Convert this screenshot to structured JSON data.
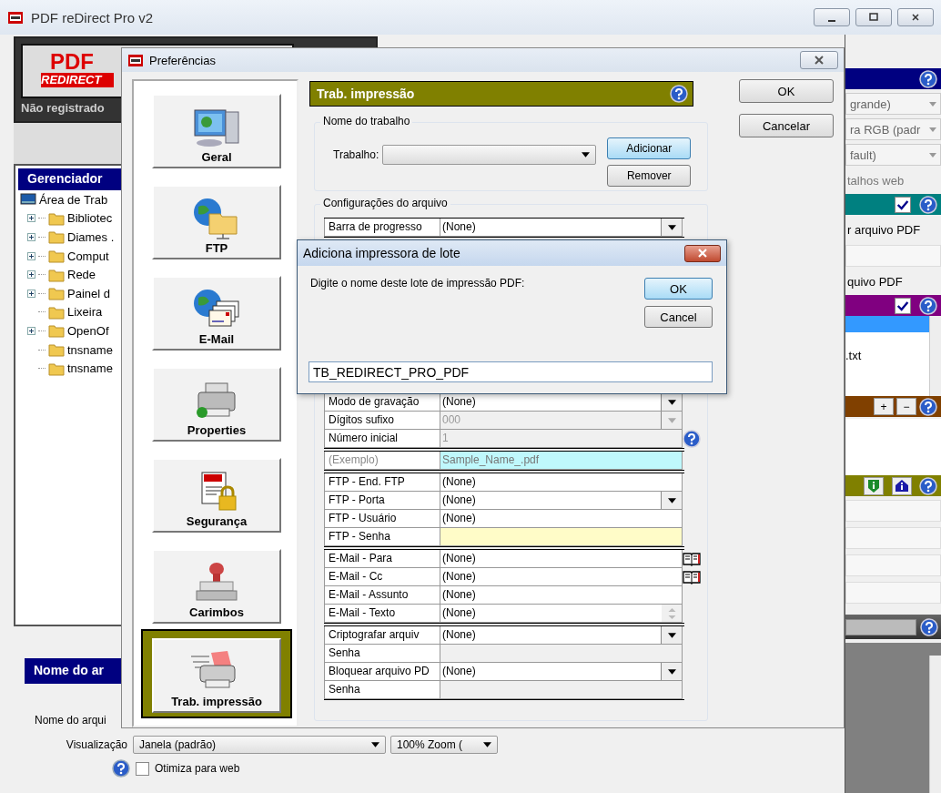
{
  "window": {
    "title": "PDF reDirect Pro v2"
  },
  "logo": {
    "line1": "PDF",
    "line2": "REDIRECT",
    "status": "Não registrado"
  },
  "explorer": {
    "title": "Gerenciador",
    "root": {
      "label": "Área de Trab",
      "children": [
        {
          "label": "Bibliotec",
          "kind": "expandable"
        },
        {
          "label": "Diames .",
          "kind": "expandable"
        },
        {
          "label": "Comput",
          "kind": "expandable"
        },
        {
          "label": "Rede",
          "kind": "expandable"
        },
        {
          "label": "Painel d",
          "kind": "expandable"
        },
        {
          "label": "Lixeira",
          "kind": "leaf"
        },
        {
          "label": "OpenOf",
          "kind": "expandable"
        },
        {
          "label": "tnsname",
          "kind": "leaf"
        },
        {
          "label": "tnsname",
          "kind": "leaf"
        }
      ]
    }
  },
  "bottom": {
    "section_title": "Nome do ar",
    "filename_label": "Nome do arqui",
    "view_label": "Visualização",
    "view_value": "Janela (padrão)",
    "zoom_value": "100% Zoom (",
    "optimize": {
      "label": "Otimiza para web",
      "checked": false
    }
  },
  "right_panel": [
    {
      "kind": "header",
      "color": "#000080"
    },
    {
      "kind": "dropdown",
      "value": "grande)"
    },
    {
      "kind": "dropdown",
      "value": "ra RGB (padr"
    },
    {
      "kind": "dropdown",
      "value": "fault)"
    },
    {
      "kind": "text",
      "value": "talhos web",
      "disabled": true
    },
    {
      "kind": "check_header",
      "color": "#008080",
      "checked": true
    },
    {
      "kind": "text",
      "value": "r arquivo PDF",
      "disabled": false
    },
    {
      "kind": "field"
    },
    {
      "kind": "text",
      "value": "quivo PDF",
      "disabled": false
    },
    {
      "kind": "check_header",
      "color": "#800080",
      "checked": true
    },
    {
      "kind": "list",
      "items": [
        {
          "selected": true
        },
        {
          "label": ".txt",
          "selected": false
        }
      ]
    },
    {
      "kind": "button_header",
      "color": "#804000",
      "buttons": [
        "+",
        "−"
      ]
    },
    {
      "kind": "blank"
    },
    {
      "kind": "info_header",
      "color": "#808000"
    },
    {
      "kind": "field"
    },
    {
      "kind": "field"
    },
    {
      "kind": "field"
    },
    {
      "kind": "field"
    },
    {
      "kind": "status"
    }
  ],
  "preferences": {
    "title": "Preferências",
    "nav": [
      {
        "label": "Geral",
        "kind": "general",
        "selected": false
      },
      {
        "label": "FTP",
        "kind": "ftp",
        "selected": false
      },
      {
        "label": "E-Mail",
        "kind": "email",
        "selected": false
      },
      {
        "label": "Properties",
        "kind": "printer",
        "selected": false
      },
      {
        "label": "Segurança",
        "kind": "security",
        "selected": false
      },
      {
        "label": "Carimbos",
        "kind": "stamp",
        "selected": false
      },
      {
        "label": "Trab. impressão",
        "kind": "print_job",
        "selected": true
      }
    ],
    "header": "Trab. impressão",
    "job_group": {
      "legend": "Nome do trabalho",
      "label": "Trabalho:",
      "add": "Adicionar",
      "remove": "Remover"
    },
    "file_group": {
      "legend": "Configurações do arquivo",
      "groups": [
        {
          "rows": [
            {
              "label": "Barra de progresso",
              "value": "(None)",
              "kind": "dropdown",
              "disabled": false
            }
          ]
        },
        {
          "rows": [
            {
              "label": "Modo de gravação",
              "value": "(None)",
              "kind": "dropdown",
              "disabled": false
            },
            {
              "label": "Dígitos sufixo",
              "value": "000",
              "kind": "dropdown",
              "disabled": true
            },
            {
              "label": "Número inicial",
              "value": "1",
              "kind": "text",
              "disabled": true,
              "side": {
                "kind": "help"
              }
            }
          ]
        },
        {
          "rows": [
            {
              "label": "(Exemplo)",
              "value": "Sample_Name_.pdf",
              "kind": "example",
              "disabled": false
            }
          ]
        },
        {
          "rows": [
            {
              "label": "FTP - End. FTP",
              "value": "(None)",
              "kind": "text",
              "disabled": false
            },
            {
              "label": "FTP - Porta",
              "value": "(None)",
              "kind": "dropdown",
              "disabled": false
            },
            {
              "label": "FTP - Usuário",
              "value": "(None)",
              "kind": "text",
              "disabled": false
            },
            {
              "label": "FTP - Senha",
              "kind": "password",
              "disabled": false
            }
          ]
        },
        {
          "rows": [
            {
              "label": "E-Mail - Para",
              "value": "(None)",
              "kind": "text",
              "disabled": false,
              "side": {
                "kind": "address_book"
              }
            },
            {
              "label": "E-Mail - Cc",
              "value": "(None)",
              "kind": "text",
              "disabled": false,
              "side": {
                "kind": "address_book"
              }
            },
            {
              "label": "E-Mail - Assunto",
              "value": "(None)",
              "kind": "text",
              "disabled": false
            },
            {
              "label": "E-Mail - Texto",
              "value": "(None)",
              "kind": "memo",
              "disabled": false
            }
          ]
        },
        {
          "rows": [
            {
              "label": "Criptografar arquiv",
              "value": "(None)",
              "kind": "dropdown",
              "disabled": false
            },
            {
              "label": "Senha",
              "kind": "text",
              "disabled": true
            },
            {
              "label": "Bloquear arquivo PD",
              "value": "(None)",
              "kind": "dropdown",
              "disabled": false
            },
            {
              "label": "Senha",
              "kind": "text",
              "disabled": true
            }
          ]
        }
      ]
    },
    "ok": "OK",
    "cancel": "Cancelar"
  },
  "batch_dialog": {
    "title": "Adiciona impressora de lote",
    "prompt": "Digite o nome deste lote de impressão PDF:",
    "ok": "OK",
    "cancel": "Cancel",
    "value": "TB_REDIRECT_PRO_PDF"
  }
}
